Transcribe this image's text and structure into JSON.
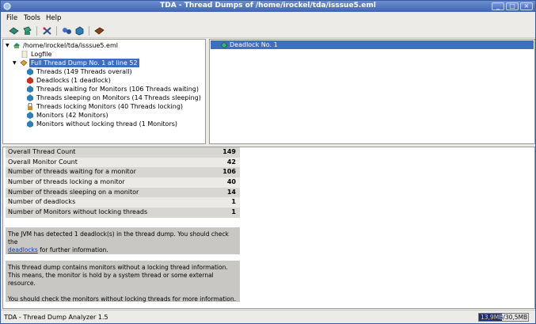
{
  "window": {
    "title": "TDA - Thread Dumps of /home/irockel/tda/isssue5.eml",
    "controls": [
      "_",
      "□",
      "×"
    ]
  },
  "menu": {
    "file": "File",
    "tools": "Tools",
    "help": "Help"
  },
  "tree": {
    "root": "/home/irockel/tda/isssue5.eml",
    "logfile": "Logfile",
    "dump": "Full Thread Dump No. 1 at line 52",
    "children": [
      "Threads (149 Threads overall)",
      "Deadlocks (1 deadlock)",
      "Threads waiting for Monitors (106 Threads waiting)",
      "Threads sleeping on Monitors (14 Threads sleeping)",
      "Threads locking Monitors (40 Threads locking)",
      "Monitors (42 Monitors)",
      "Monitors without locking thread (1 Monitors)"
    ]
  },
  "deadlock_list": {
    "item": "Deadlock No. 1"
  },
  "stats": [
    {
      "label": "Overall Thread Count",
      "value": "149"
    },
    {
      "label": "Overall Monitor Count",
      "value": "42"
    },
    {
      "label": "Number of threads waiting for a monitor",
      "value": "106"
    },
    {
      "label": "Number of threads locking a monitor",
      "value": "40"
    },
    {
      "label": "Number of threads sleeping on a monitor",
      "value": "14"
    },
    {
      "label": "Number of deadlocks",
      "value": "1"
    },
    {
      "label": "Number of Monitors without locking threads",
      "value": "1"
    }
  ],
  "info1": {
    "text_before": "The JVM has detected 1 deadlock(s) in the thread dump. You should check the",
    "link": "deadlocks",
    "text_after": " for further information."
  },
  "info2": {
    "line1": "This thread dump contains monitors without a locking thread information.",
    "line2": "This means, the monitor is hold by a system thread or some external",
    "line3": "resource.",
    "line4": "You should check the monitors without locking threads for more information."
  },
  "status": {
    "text": "TDA - Thread Dump Analyzer 1.5",
    "memory": "13,9MB/30,5MB",
    "memory_fraction": 0.46
  },
  "colors": {
    "selection": "#3d6ec0",
    "link": "#1a34b8"
  }
}
